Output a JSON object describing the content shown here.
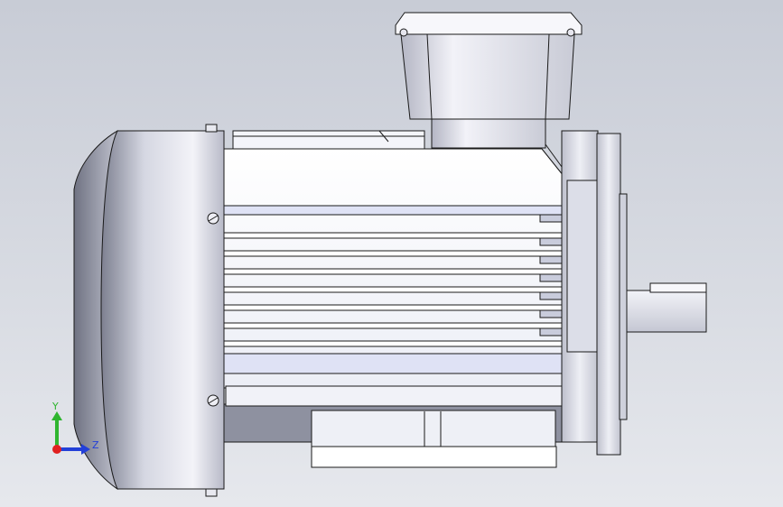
{
  "viewport": {
    "background_top": "#c8ccd6",
    "background_bottom": "#e6e8ed"
  },
  "model": {
    "name": "electric-motor",
    "body_color": "#f4f4fb",
    "shade_color": "#a9acbd",
    "outline_color": "#1a1a1a"
  },
  "triad": {
    "y_label": "Y",
    "z_label": "Z",
    "y_color": "#2fb52f",
    "z_color": "#2340d8",
    "origin_color": "#e02020"
  }
}
